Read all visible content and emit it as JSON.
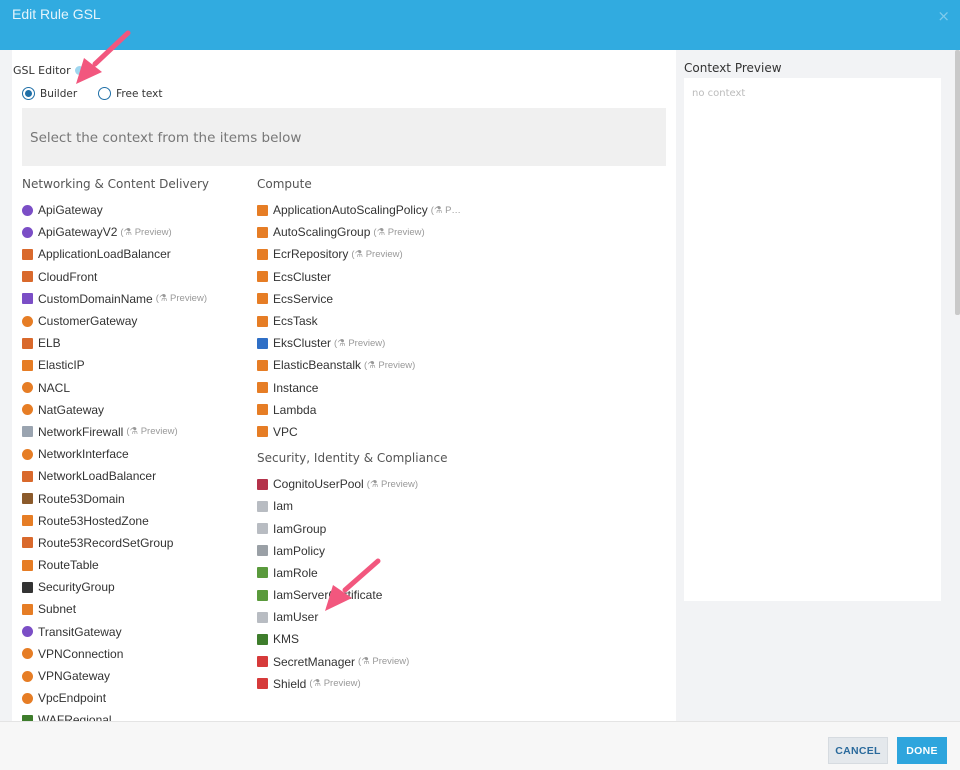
{
  "header": {
    "title": "Edit Rule GSL",
    "close_icon": "×"
  },
  "editor": {
    "label": "GSL Editor",
    "modes": [
      {
        "label": "Builder",
        "checked": true
      },
      {
        "label": "Free text",
        "checked": false
      }
    ],
    "context_placeholder": "Select the context from the items below"
  },
  "preview_tag": "Preview",
  "networking": {
    "header": "Networking & Content Delivery",
    "items": [
      {
        "label": "ApiGateway",
        "icon": "api-gateway-icon",
        "color": "#7b4ec6",
        "preview": false
      },
      {
        "label": "ApiGatewayV2",
        "icon": "api-gateway-icon",
        "color": "#7b4ec6",
        "preview": true
      },
      {
        "label": "ApplicationLoadBalancer",
        "icon": "load-balancer-icon",
        "color": "#d9692c",
        "preview": false
      },
      {
        "label": "CloudFront",
        "icon": "cloudfront-icon",
        "color": "#d9692c",
        "preview": false
      },
      {
        "label": "CustomDomainName",
        "icon": "domain-icon",
        "color": "#7b4ec6",
        "preview": true
      },
      {
        "label": "CustomerGateway",
        "icon": "gateway-icon",
        "color": "#e67d25",
        "preview": false
      },
      {
        "label": "ELB",
        "icon": "load-balancer-icon",
        "color": "#d9692c",
        "preview": false
      },
      {
        "label": "ElasticIP",
        "icon": "ip-icon",
        "color": "#e67d25",
        "preview": false
      },
      {
        "label": "NACL",
        "icon": "nacl-icon",
        "color": "#e67d25",
        "preview": false
      },
      {
        "label": "NatGateway",
        "icon": "nat-icon",
        "color": "#e67d25",
        "preview": false
      },
      {
        "label": "NetworkFirewall",
        "icon": "firewall-icon",
        "color": "#9aa4b0",
        "preview": true
      },
      {
        "label": "NetworkInterface",
        "icon": "interface-icon",
        "color": "#e67d25",
        "preview": false
      },
      {
        "label": "NetworkLoadBalancer",
        "icon": "load-balancer-icon",
        "color": "#d9692c",
        "preview": false
      },
      {
        "label": "Route53Domain",
        "icon": "route53-icon",
        "color": "#8b5a2b",
        "preview": false
      },
      {
        "label": "Route53HostedZone",
        "icon": "route53-icon",
        "color": "#e67d25",
        "preview": false
      },
      {
        "label": "Route53RecordSetGroup",
        "icon": "route53-icon",
        "color": "#d9692c",
        "preview": false
      },
      {
        "label": "RouteTable",
        "icon": "route-table-icon",
        "color": "#e67d25",
        "preview": false
      },
      {
        "label": "SecurityGroup",
        "icon": "shield-icon",
        "color": "#333333",
        "preview": false
      },
      {
        "label": "Subnet",
        "icon": "lock-icon",
        "color": "#e67d25",
        "preview": false
      },
      {
        "label": "TransitGateway",
        "icon": "transit-gateway-icon",
        "color": "#7b4ec6",
        "preview": false
      },
      {
        "label": "VPNConnection",
        "icon": "vpn-icon",
        "color": "#e67d25",
        "preview": false
      },
      {
        "label": "VPNGateway",
        "icon": "vpn-icon",
        "color": "#e67d25",
        "preview": false
      },
      {
        "label": "VpcEndpoint",
        "icon": "endpoint-icon",
        "color": "#e67d25",
        "preview": false
      },
      {
        "label": "WAFRegional",
        "icon": "waf-icon",
        "color": "#3e7d2c",
        "preview": false
      }
    ]
  },
  "compute": {
    "header": "Compute",
    "items": [
      {
        "label": "ApplicationAutoScalingPolicy",
        "icon": "autoscaling-icon",
        "color": "#e67d25",
        "preview": true,
        "truncated": "P…"
      },
      {
        "label": "AutoScalingGroup",
        "icon": "autoscaling-icon",
        "color": "#e67d25",
        "preview": true
      },
      {
        "label": "EcrRepository",
        "icon": "ecr-icon",
        "color": "#e67d25",
        "preview": true
      },
      {
        "label": "EcsCluster",
        "icon": "ecs-icon",
        "color": "#e67d25",
        "preview": false
      },
      {
        "label": "EcsService",
        "icon": "ecs-icon",
        "color": "#e67d25",
        "preview": false
      },
      {
        "label": "EcsTask",
        "icon": "ecs-icon",
        "color": "#e67d25",
        "preview": false
      },
      {
        "label": "EksCluster",
        "icon": "eks-icon",
        "color": "#2f6fc6",
        "preview": true
      },
      {
        "label": "ElasticBeanstalk",
        "icon": "beanstalk-icon",
        "color": "#e67d25",
        "preview": true
      },
      {
        "label": "Instance",
        "icon": "instance-icon",
        "color": "#e67d25",
        "preview": false
      },
      {
        "label": "Lambda",
        "icon": "lambda-icon",
        "color": "#e67d25",
        "preview": false
      },
      {
        "label": "VPC",
        "icon": "vpc-icon",
        "color": "#e67d25",
        "preview": false
      }
    ]
  },
  "security": {
    "header": "Security, Identity & Compliance",
    "items": [
      {
        "label": "CognitoUserPool",
        "icon": "cognito-icon",
        "color": "#b4324a",
        "preview": true
      },
      {
        "label": "Iam",
        "icon": "iam-icon",
        "color": "#b8bcc2",
        "preview": false
      },
      {
        "label": "IamGroup",
        "icon": "iam-group-icon",
        "color": "#b8bcc2",
        "preview": false
      },
      {
        "label": "IamPolicy",
        "icon": "iam-policy-icon",
        "color": "#9aa0a6",
        "preview": false
      },
      {
        "label": "IamRole",
        "icon": "iam-role-icon",
        "color": "#5a9a3c",
        "preview": false
      },
      {
        "label": "IamServerCertificate",
        "icon": "certificate-icon",
        "color": "#5a9a3c",
        "preview": false
      },
      {
        "label": "IamUser",
        "icon": "user-icon",
        "color": "#b8bcc2",
        "preview": false
      },
      {
        "label": "KMS",
        "icon": "kms-icon",
        "color": "#3e7d2c",
        "preview": false
      },
      {
        "label": "SecretManager",
        "icon": "secret-icon",
        "color": "#d63a3a",
        "preview": true
      },
      {
        "label": "Shield",
        "icon": "shield-icon",
        "color": "#d63a3a",
        "preview": true
      }
    ]
  },
  "context_preview": {
    "title": "Context Preview",
    "empty_text": "no context"
  },
  "footer": {
    "cancel_label": "CANCEL",
    "done_label": "DONE"
  },
  "colors": {
    "header": "#31abe0",
    "accent": "#2ea5dd",
    "annotation_arrow": "#f2577e"
  }
}
